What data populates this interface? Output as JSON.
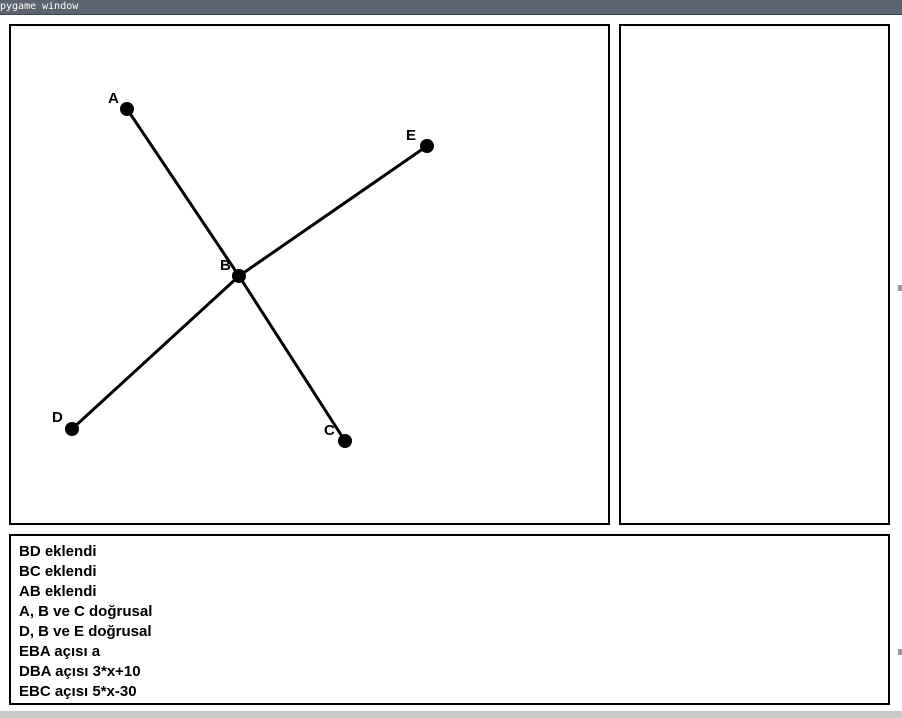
{
  "window": {
    "title": "pygame window"
  },
  "points": [
    {
      "id": "A",
      "label": "A"
    },
    {
      "id": "B",
      "label": "B"
    },
    {
      "id": "C",
      "label": "C"
    },
    {
      "id": "D",
      "label": "D"
    },
    {
      "id": "E",
      "label": "E"
    }
  ],
  "segments": [
    {
      "name": "AB",
      "from": "A",
      "to": "B"
    },
    {
      "name": "BC",
      "from": "B",
      "to": "C"
    },
    {
      "name": "BD",
      "from": "B",
      "to": "D"
    },
    {
      "name": "BE",
      "from": "B",
      "to": "E"
    }
  ],
  "log": [
    "BD eklendi",
    "BC eklendi",
    "AB eklendi",
    "A, B ve C doğrusal",
    "D, B ve E doğrusal",
    "EBA açısı a",
    "DBA açısı 3*x+10",
    "EBC açısı 5*x-30"
  ],
  "colors": {
    "titlebar": "#5b6470",
    "ink": "#000000",
    "background": "#ffffff"
  }
}
